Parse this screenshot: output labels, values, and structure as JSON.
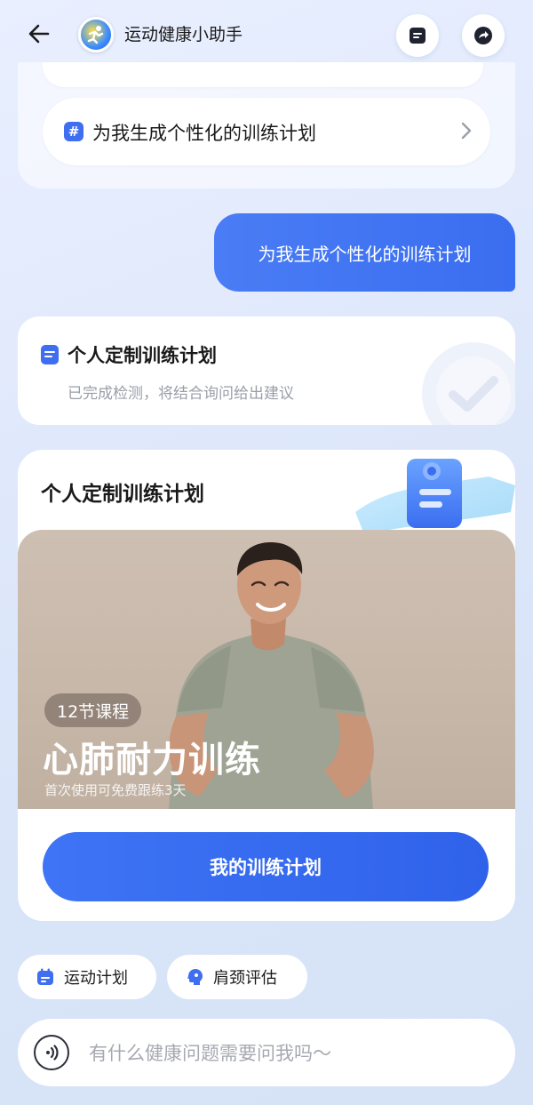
{
  "header": {
    "title": "运动健康小助手"
  },
  "suggestion": {
    "text": "为我生成个性化的训练计划",
    "hash_symbol": "#"
  },
  "user_message": {
    "text": "为我生成个性化的训练计划"
  },
  "status_card": {
    "title": "个人定制训练计划",
    "subtitle": "已完成检测，将结合询问给出建议"
  },
  "plan_card": {
    "title": "个人定制训练计划",
    "course_count": "12节课程",
    "course_title": "心肺耐力训练",
    "course_note": "首次使用可免费跟练3天",
    "button_label": "我的训练计划"
  },
  "quick_actions": [
    {
      "label": "运动计划",
      "icon": "calendar-icon"
    },
    {
      "label": "肩颈评估",
      "icon": "head-profile-icon"
    }
  ],
  "input": {
    "placeholder": "有什么健康问题需要问我吗～"
  },
  "colors": {
    "accent": "#3a6ef0",
    "background": "#dfe8fb",
    "muted_text": "#9a9ea8"
  }
}
